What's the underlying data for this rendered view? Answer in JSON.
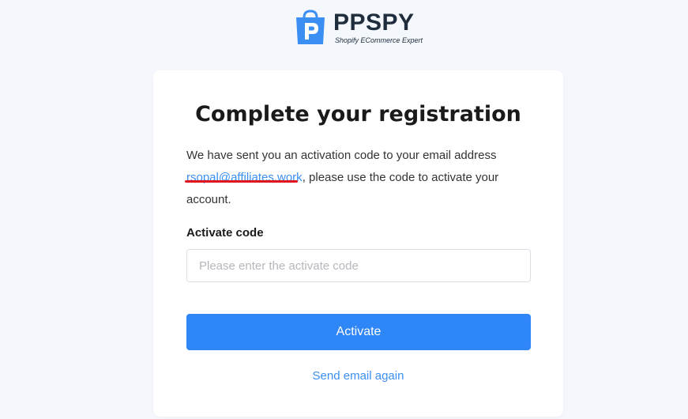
{
  "brand": {
    "name_pp": "PP",
    "name_spy": "SPY",
    "tagline": "Shopify ECommerce Expert",
    "icon": "shopping-bag-p-icon",
    "color": "#3b8ff3"
  },
  "card": {
    "title": "Complete your registration",
    "description_before": "We have sent you an activation code to your email address",
    "email": "rsopal@affiliates.work",
    "description_after": ", please use the code to activate your account.",
    "code_label": "Activate code",
    "code_placeholder": "Please enter the activate code",
    "code_value": "",
    "activate_label": "Activate",
    "resend_label": "Send email again"
  },
  "colors": {
    "accent": "#2f86f6",
    "link": "#3b8ff3",
    "redaction": "#e0141c"
  }
}
